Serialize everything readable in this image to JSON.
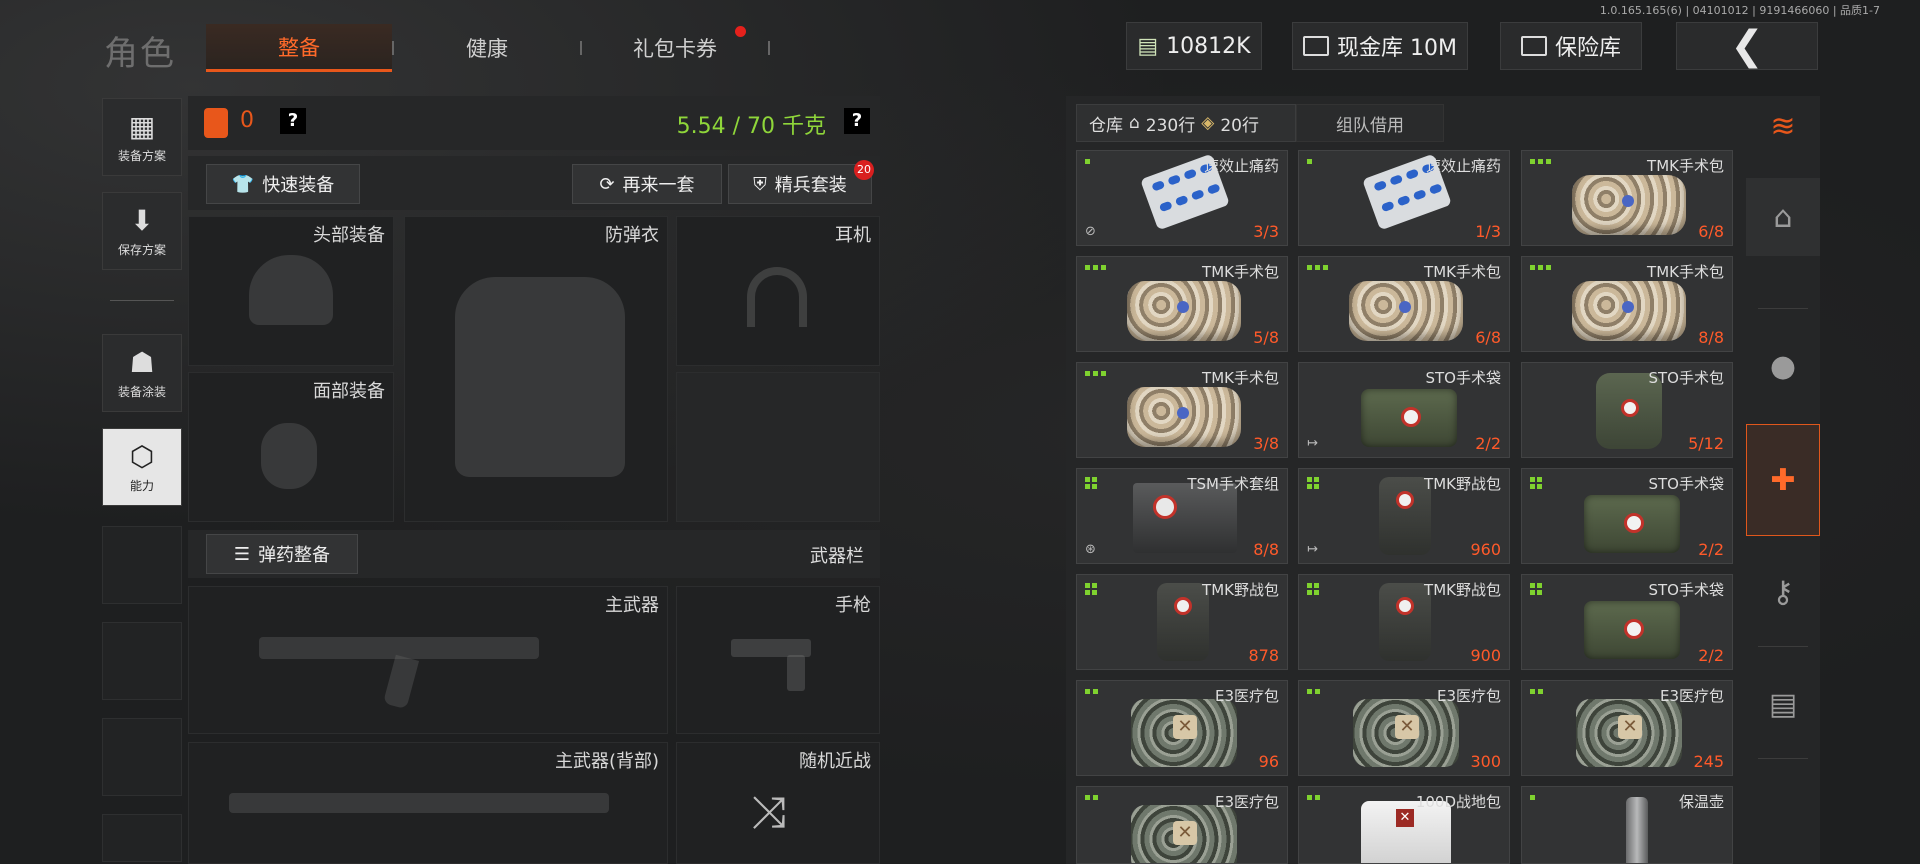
{
  "version": "1.0.165.165(6) | 04101012 | 9191466060 | 品质1-7",
  "title": "角色",
  "tabs": [
    {
      "label": "整备",
      "active": true
    },
    {
      "label": "健康",
      "active": false
    },
    {
      "label": "礼包卡券",
      "active": false,
      "notify_dot": true
    }
  ],
  "currency": {
    "cash": "10812K",
    "vault": "现金库 10M",
    "insurance": "保险库"
  },
  "left_menu": [
    "装备方案",
    "保存方案",
    "装备涂装",
    "能力"
  ],
  "equip": {
    "armor_count": "0",
    "help": "?",
    "weight": "5.54 / 70 千克",
    "quick_equip": "快速装备",
    "random_set": "再来一套",
    "elite_set": "精兵套装",
    "elite_badge": "20",
    "slots": {
      "head": "头部装备",
      "vest": "防弹衣",
      "headset": "耳机",
      "face": "面部装备",
      "ammo": "弹药整备",
      "weapon_bar": "武器栏",
      "primary": "主武器",
      "pistol": "手枪",
      "primary_back": "主武器(背部)",
      "melee": "随机近战"
    }
  },
  "warehouse": {
    "tab_label": "仓库",
    "rows_home": "230行",
    "rows_extra": "20行",
    "team_borrow": "组队借用",
    "items": [
      {
        "name": "速效止痛药",
        "count": "3/3",
        "tier": 1,
        "art": "pills",
        "corner": "⊘"
      },
      {
        "name": "速效止痛药",
        "count": "1/3",
        "tier": 1,
        "art": "pills"
      },
      {
        "name": "TMK手术包",
        "count": "6/8",
        "tier": 3,
        "art": "camo"
      },
      {
        "name": "TMK手术包",
        "count": "5/8",
        "tier": 3,
        "art": "camo"
      },
      {
        "name": "TMK手术包",
        "count": "6/8",
        "tier": 3,
        "art": "camo"
      },
      {
        "name": "TMK手术包",
        "count": "8/8",
        "tier": 3,
        "art": "camo"
      },
      {
        "name": "TMK手术包",
        "count": "3/8",
        "tier": 3,
        "art": "camo"
      },
      {
        "name": "STO手术袋",
        "count": "2/2",
        "tier": 0,
        "art": "sto",
        "corner": "↦"
      },
      {
        "name": "STO手术包",
        "count": "5/12",
        "tier": 0,
        "art": "stobag"
      },
      {
        "name": "TSM手术套组",
        "count": "8/8",
        "tier": 4,
        "art": "tsm",
        "corner": "⊛"
      },
      {
        "name": "TMK野战包",
        "count": "960",
        "tier": 4,
        "art": "pack",
        "corner": "↦"
      },
      {
        "name": "STO手术袋",
        "count": "2/2",
        "tier": 4,
        "art": "sto"
      },
      {
        "name": "TMK野战包",
        "count": "878",
        "tier": 4,
        "art": "pack"
      },
      {
        "name": "TMK野战包",
        "count": "900",
        "tier": 4,
        "art": "pack"
      },
      {
        "name": "STO手术袋",
        "count": "2/2",
        "tier": 4,
        "art": "sto"
      },
      {
        "name": "E3医疗包",
        "count": "96",
        "tier": 2,
        "art": "e3"
      },
      {
        "name": "E3医疗包",
        "count": "300",
        "tier": 2,
        "art": "e3"
      },
      {
        "name": "E3医疗包",
        "count": "245",
        "tier": 2,
        "art": "e3"
      },
      {
        "name": "E3医疗包",
        "count": "",
        "tier": 2,
        "art": "e3"
      },
      {
        "name": "100D战地包",
        "count": "",
        "tier": 2,
        "art": "d100"
      },
      {
        "name": "保温壶",
        "count": "",
        "tier": 1,
        "art": "flask"
      }
    ]
  },
  "colors": {
    "accent": "#e8571b",
    "count": "#ff5a2a",
    "weight": "#8fd63a",
    "tier_dot": "#7fd22f"
  }
}
